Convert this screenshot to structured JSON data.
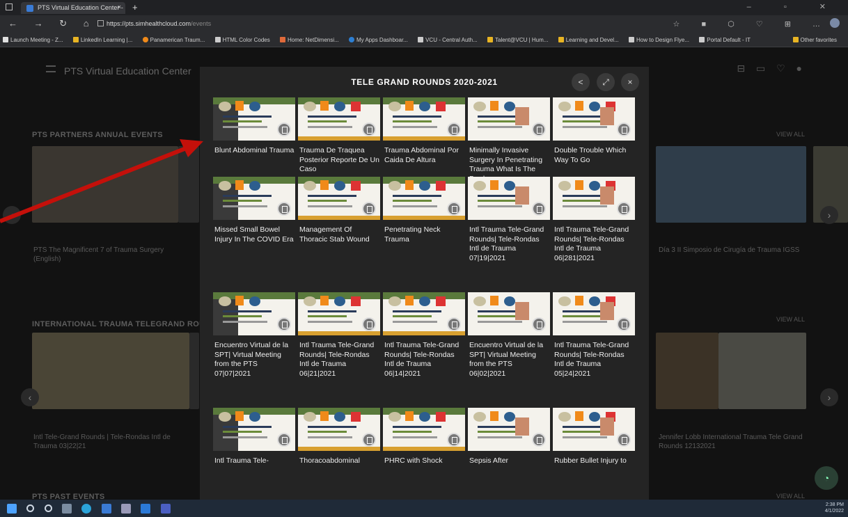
{
  "browser": {
    "tab_title": "PTS Virtual Education Center - ",
    "tab_close": "×",
    "new_tab": "+",
    "url_host": "https://pts.simhealthcloud.com",
    "url_path": "/events",
    "nav_icons": "← → ↻ ⌂",
    "tool_icons": "☆ ■ ⬡ ♡ ⊞ …",
    "bookmarks": [
      {
        "label": "Launch Meeting - Z...",
        "color": "#e0e0e0"
      },
      {
        "label": "LinkedIn Learning |...",
        "color": "#e8b423"
      },
      {
        "label": "Panamerican Traum...",
        "color": "#f08a1a"
      },
      {
        "label": "HTML Color Codes",
        "color": "#cccccc"
      },
      {
        "label": "Home: NetDimensi...",
        "color": "#e06a3a"
      },
      {
        "label": "My Apps Dashboar...",
        "color": "#2d7fd3"
      },
      {
        "label": "VCU - Central Auth...",
        "color": "#cccccc"
      },
      {
        "label": "Talent@VCU | Hum...",
        "color": "#e8b423"
      },
      {
        "label": "Learning and Devel...",
        "color": "#e8b423"
      },
      {
        "label": "How to Design Flye...",
        "color": "#cccccc"
      },
      {
        "label": "Portal Default - IT",
        "color": "#cccccc"
      }
    ],
    "other_favorites": "Other favorites"
  },
  "page": {
    "header_title": "PTS Virtual Education Center",
    "sections": [
      {
        "title": "PTS PARTNERS ANNUAL EVENTS",
        "view_all": "VIEW ALL"
      },
      {
        "title": "INTERNATIONAL TRAUMA TELEGRAND ROUN",
        "view_all": "VIEW ALL"
      },
      {
        "title": "PTS PAST EVENTS",
        "view_all": "VIEW ALL"
      }
    ],
    "row1_captions": [
      "PTS The Magnificent 7 of Trauma Surgery (English)",
      "Día 3 II Simposio de Cirugía de Trauma IGSS"
    ],
    "row2_captions": [
      "Intl Tele-Grand Rounds | Tele-Rondas Intl de Trauma 03|22|21",
      "Jennifer Lobb International Trauma Tele Grand Rounds 12132021"
    ]
  },
  "modal": {
    "title": "TELE GRAND ROUNDS 2020-2021",
    "share_icon": "<",
    "expand_icon": "⤢",
    "close_icon": "×",
    "items": [
      "Blunt Abdominal Trauma",
      "Trauma De Traquea Posterior Reporte De Un Caso",
      "Trauma Abdominal Por Caida De Altura",
      "Minimally Invasive Surgery In Penetrating Trauma What Is The Border",
      "Double Trouble Which Way To Go",
      "Missed Small Bowel Injury In The COVID Era",
      "Management Of Thoracic Stab Wound",
      "Penetrating Neck Trauma",
      "Intl Trauma Tele-Grand Rounds| Tele-Rondas Intl de Trauma 07|19|2021",
      "Intl Trauma Tele-Grand Rounds| Tele-Rondas Intl de Trauma 06|281|2021",
      "Encuentro Virtual de la SPT| Virtual Meeting from the PTS 07|07|2021",
      "Intl Trauma Tele-Grand Rounds| Tele-Rondas Intl de Trauma 06|21|2021",
      "Intl Trauma Tele-Grand Rounds| Tele-Rondas Intl de Trauma 06|14|2021",
      "Encuentro Virtual de la SPT| Virtual Meeting from the PTS 06|02|2021",
      "Intl Trauma Tele-Grand Rounds| Tele-Rondas Intl de Trauma 05|24|2021",
      "Intl Trauma Tele-",
      "Thoracoabdominal",
      "PHRC with Shock",
      "Sepsis After",
      "Rubber Bullet Injury to"
    ]
  },
  "taskbar": {
    "time": "2:38 PM",
    "date": "4/1/2022"
  }
}
